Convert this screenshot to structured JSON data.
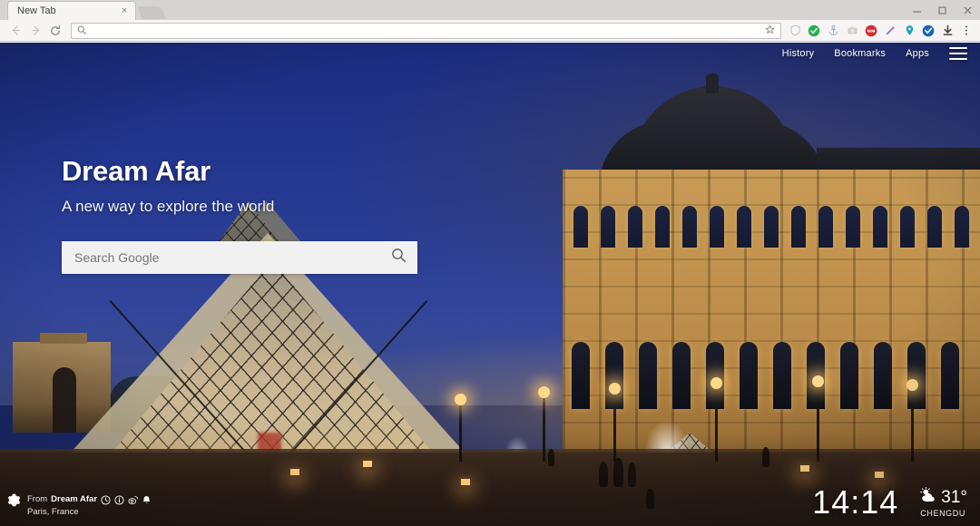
{
  "browser": {
    "tab": {
      "title": "New Tab",
      "close_label": "×"
    },
    "new_tab_button_name": "new-tab-button",
    "window_controls": {
      "minimize": "—",
      "maximize": "❐",
      "close": "✕"
    },
    "nav": {
      "back": "←",
      "forward": "→",
      "reload": "⟳"
    },
    "omnibox": {
      "value": "",
      "placeholder": "",
      "search_icon": "search-icon",
      "star_icon": "bookmark-star-icon"
    },
    "extensions": [
      {
        "name": "shield-icon",
        "glyph": "⌂",
        "color": "#b9b9b9"
      },
      {
        "name": "green-check-circle-icon",
        "glyph": "✔",
        "color": "#22b14c"
      },
      {
        "name": "anchor-icon",
        "glyph": "⚓",
        "color": "#8aa6c4"
      },
      {
        "name": "camera-icon",
        "glyph": "■",
        "color": "#c7c7c7"
      },
      {
        "name": "adblock-abp-icon",
        "glyph": "ABP",
        "color": "#d32f2f"
      },
      {
        "name": "pen-icon",
        "glyph": "╱",
        "color": "#9b6ad6"
      },
      {
        "name": "location-pin-icon",
        "glyph": "⚉",
        "color": "#1aa3b8"
      },
      {
        "name": "blue-check-circle-icon",
        "glyph": "✔",
        "color": "#1565c0"
      },
      {
        "name": "download-icon",
        "glyph": "⬇",
        "color": "#4a4a4a"
      },
      {
        "name": "chrome-menu-icon",
        "glyph": "⋮",
        "color": "#5a5a5a"
      }
    ]
  },
  "page": {
    "topnav": {
      "links": [
        {
          "label": "History",
          "name": "nav-link-history"
        },
        {
          "label": "Bookmarks",
          "name": "nav-link-bookmarks"
        },
        {
          "label": "Apps",
          "name": "nav-link-apps"
        }
      ],
      "menu_icon": "hamburger-menu-icon"
    },
    "hero": {
      "title": "Dream Afar",
      "subtitle": "A new way to explore the world",
      "search": {
        "value": "",
        "placeholder": "Search Google",
        "icon": "search-icon"
      }
    },
    "attribution": {
      "gear_icon": "settings-gear-icon",
      "from_prefix": "From",
      "brand": "Dream Afar",
      "location": "Paris, France",
      "social": [
        {
          "name": "clock-circle-icon",
          "glyph": "◴"
        },
        {
          "name": "info-circle-icon",
          "glyph": "ⓘ"
        },
        {
          "name": "weibo-icon",
          "glyph": "◎"
        },
        {
          "name": "bell-icon",
          "glyph": "☁"
        }
      ]
    },
    "status": {
      "time": "14:14",
      "weather_icon": "sun-behind-cloud-icon",
      "temperature": "31°",
      "city": "CHENGDU"
    },
    "colors": {
      "sky_top": "#1b2c7e",
      "sky_bottom": "#3c4a88",
      "palace_gold": "#c79a55",
      "ground": "#2a1d15",
      "search_bg": "#f1f1f1",
      "lamp_glow": "#ffd98a"
    }
  }
}
